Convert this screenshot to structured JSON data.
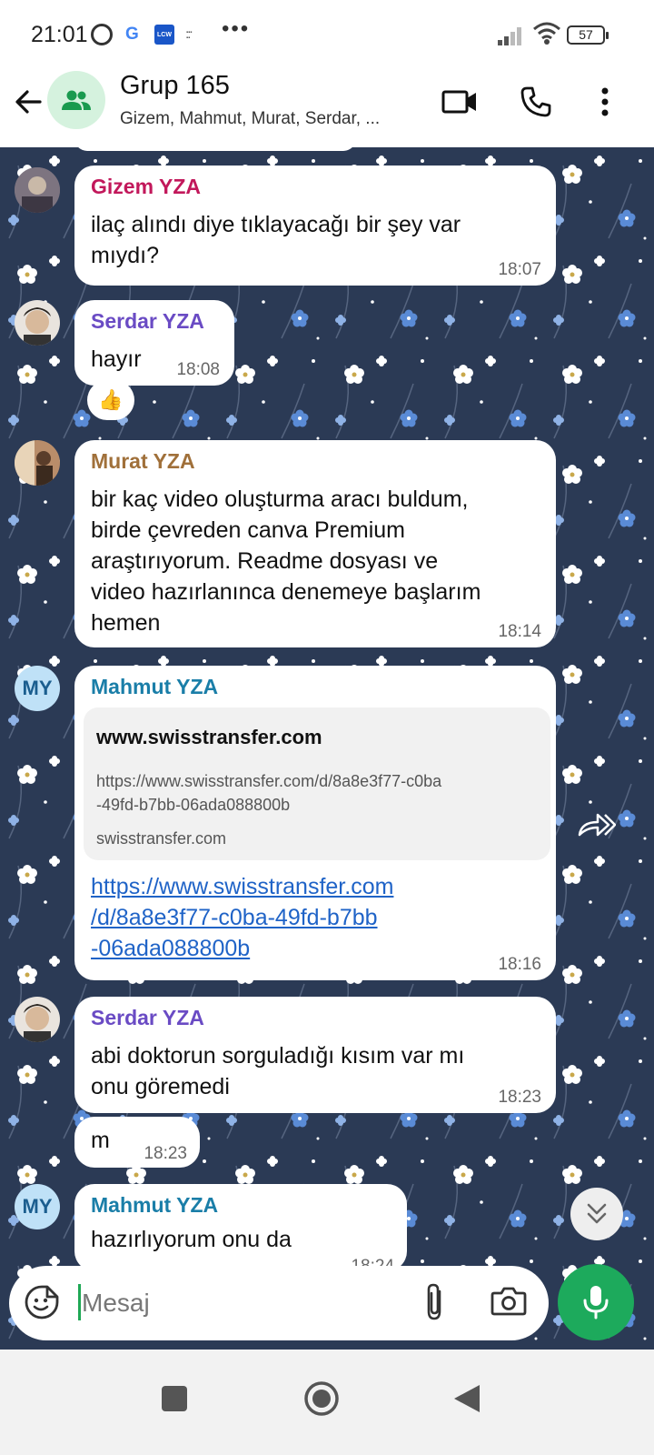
{
  "status_bar": {
    "time": "21:01",
    "lcw_label": "LCW",
    "battery": "57"
  },
  "header": {
    "title": "Grup 165",
    "members": "Gizem, Mahmut, Murat, Serdar, ..."
  },
  "messages": [
    {
      "sender": "Gizem YZA",
      "sender_color": "#c2185b",
      "text_lines": [
        "ilaç alındı diye tıklayacağı bir şey var",
        "mıydı?"
      ],
      "time": "18:07"
    },
    {
      "sender": "Serdar YZA",
      "sender_color": "#6a4bc4",
      "text_lines": [
        "hayır"
      ],
      "time": "18:08",
      "reaction": "👍"
    },
    {
      "sender": "Murat YZA",
      "sender_color": "#a0703a",
      "text_lines": [
        "bir kaç video oluşturma aracı buldum,",
        "birde çevreden canva Premium",
        "araştırıyorum. Readme dosyası ve",
        "video hazırlanınca denemeye başlarım",
        "hemen"
      ],
      "time": "18:14"
    },
    {
      "sender": "Mahmut YZA",
      "sender_color": "#1a7ea8",
      "avatar_initials": "MY",
      "preview": {
        "title": "www.swisstransfer.com",
        "url_lines": [
          "https://www.swisstransfer.com/d/8a8e3f77-c0ba",
          "-49fd-b7bb-06ada088800b"
        ],
        "domain": "swisstransfer.com"
      },
      "link_lines": [
        "https://www.swisstransfer.com",
        "/d/8a8e3f77-c0ba-49fd-b7bb",
        "-06ada088800b"
      ],
      "time": "18:16"
    },
    {
      "sender": "Serdar YZA",
      "sender_color": "#6a4bc4",
      "text_lines": [
        "abi doktorun sorguladığı kısım var mı",
        "onu göremedi"
      ],
      "time": "18:23"
    },
    {
      "text_lines": [
        "m"
      ],
      "time": "18:23"
    },
    {
      "sender": "Mahmut YZA",
      "sender_color": "#1a7ea8",
      "avatar_initials": "MY",
      "text_lines": [
        "hazırlıyorum onu da"
      ],
      "time": "18:24"
    }
  ],
  "composer": {
    "placeholder": "Mesaj"
  },
  "icons": {
    "back": "arrow-left-icon",
    "group": "group-icon",
    "video": "video-call-icon",
    "phone": "phone-icon",
    "more": "more-vert-icon",
    "emoji": "sticker-icon",
    "attach": "paperclip-icon",
    "camera": "camera-icon",
    "mic": "mic-icon"
  },
  "colors": {
    "accent": "#1daa5c",
    "chat_background": "#2b3a55",
    "link": "#1f63c7"
  }
}
